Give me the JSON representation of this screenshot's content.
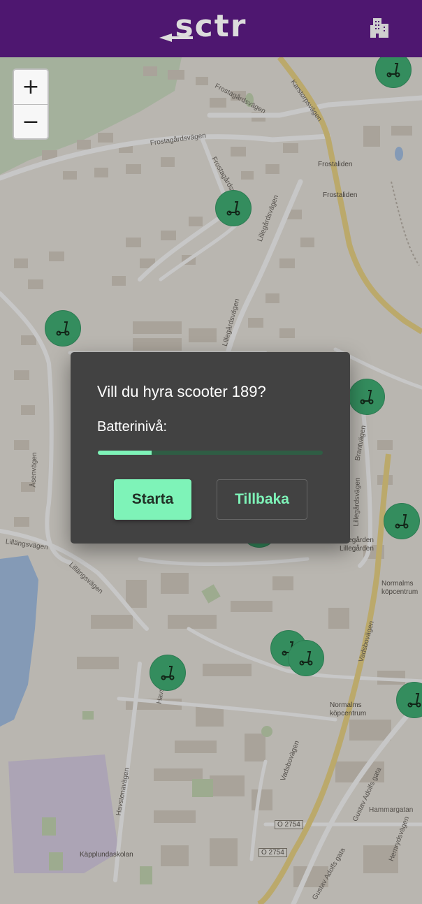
{
  "header": {
    "logo_text": "sctr",
    "logo_icon": "sctr-logo",
    "building_icon": "building-icon"
  },
  "zoom": {
    "in_label": "+",
    "out_label": "−"
  },
  "map": {
    "street_labels": [
      "Frostagårdsvägen",
      "Frostagårdsvägen",
      "Frostagårdsvägen",
      "Karstorpsvägen",
      "Lillegårdsvägen",
      "Lillegårdsvägen",
      "Åsenvägen",
      "Lillängsvägen",
      "Lillängsvägen",
      "Brantvägen",
      "Lillegårdsvägen",
      "Vadsbovägen",
      "Vadsbovägen",
      "Havstenavägen",
      "Havstenavägen",
      "Gustav Adolfs gata",
      "Gustav Adolfs gata",
      "Hammargatan",
      "Hemrydsvägen"
    ],
    "stops": [
      "Frostaliden",
      "Frostaliden",
      "Lillegården",
      "Lillegården",
      "Normalms köpcentrum",
      "Normalms köpcentrum",
      "Käpplundaskolan"
    ],
    "road_shields": [
      "O 2754",
      "O 2754"
    ],
    "scooter_icon": "scooter-icon"
  },
  "dialog": {
    "title": "Vill du hyra scooter 189?",
    "battery_label": "Batterinivå:",
    "battery_level": 0.24,
    "start_label": "Starta",
    "back_label": "Tillbaka"
  },
  "colors": {
    "header": "#4e1770",
    "accent": "#7ef3b8",
    "scooter": "#43b579",
    "dialog": "#424242"
  }
}
